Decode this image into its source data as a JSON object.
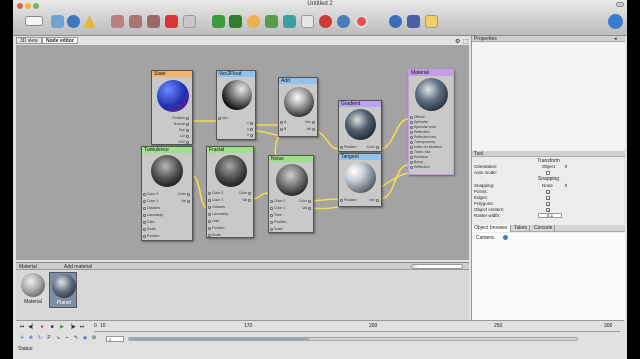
{
  "window": {
    "title": "Untitled 2"
  },
  "tabs": [
    "3D view",
    "Node editor"
  ],
  "nodes": {
    "state": {
      "title": "State",
      "outputs": [
        "Position",
        "Normal",
        "Eye",
        "UV",
        "UV2",
        "Tan"
      ]
    },
    "vec2float": {
      "title": "Vec2Float",
      "inputs": [
        "Vec"
      ],
      "outputs": [
        "x",
        "y",
        "z"
      ]
    },
    "add": {
      "title": "Add",
      "inputs": [
        "A",
        "B"
      ],
      "outputs": [
        "Vec",
        "Val"
      ]
    },
    "gradient": {
      "title": "Gradient",
      "inputs": [
        "Position"
      ],
      "outputs": [
        "Color",
        "Val"
      ]
    },
    "material": {
      "title": "Material",
      "inputs": [
        "Diffuse",
        "Specular",
        "Specular color",
        "Reflection",
        "Reflection blur",
        "Transparency",
        "Index of refraction",
        "Trans. blur",
        "Emission",
        "Bump",
        "Reflection"
      ]
    },
    "turbulence": {
      "title": "Turbulence",
      "inputs": [
        "Color 0",
        "Color 1",
        "Octaves",
        "Lacunarity",
        "Gain",
        "Scale",
        "Position"
      ],
      "outputs": [
        "Color",
        "Val"
      ]
    },
    "fractal": {
      "title": "Fractal",
      "inputs": [
        "Color 0",
        "Color 1",
        "Octaves",
        "Lacunarity",
        "Gain",
        "Position",
        "Scale"
      ],
      "outputs": [
        "Color",
        "Val"
      ]
    },
    "noise": {
      "title": "Noise",
      "inputs": [
        "Color 0",
        "Color 1",
        "Time",
        "Position",
        "Scale"
      ],
      "outputs": [
        "Color",
        "Val"
      ]
    },
    "tangent": {
      "title": "Tangent",
      "inputs": [
        "Position"
      ],
      "outputs": [
        "Vec",
        "Val"
      ]
    }
  },
  "material_strip": {
    "header": "Material",
    "add_label": "Add material",
    "search_placeholder": "Q~",
    "items": [
      "Material",
      "Planet"
    ]
  },
  "right": {
    "properties_header": "Properties",
    "tool_header": "Tool",
    "transform_title": "Transform",
    "orientation_label": "Orientation:",
    "orientation_value": "Object",
    "automode_label": "Auto mode:",
    "snapping_title": "Snapping",
    "snapping_label": "Snapping:",
    "snapping_value": "None",
    "points_label": "Points:",
    "edges_label": "Edges:",
    "polygons_label": "Polygons:",
    "object_centers_label": "Object centers:",
    "raster_label": "Raster width:",
    "raster_value": "0.1",
    "browser_tabs": [
      "Object browser",
      "Takes",
      "Console"
    ],
    "objects": [
      "Camera"
    ]
  },
  "timeline": {
    "ticks": [
      "0",
      "10",
      "170",
      "200",
      "250",
      "300"
    ],
    "frame_value": "0",
    "status_label": "Status:"
  },
  "colors": {
    "state": "#f4b46a",
    "vec2float": "#8fc3ee",
    "add": "#8fc3ee",
    "gradient": "#b8a3ee",
    "material": "#c79ae8",
    "turbulence": "#9fe08a",
    "fractal": "#9fe08a",
    "noise": "#9fe08a",
    "tangent": "#8fc3ee",
    "wire": "#f0e04c"
  }
}
